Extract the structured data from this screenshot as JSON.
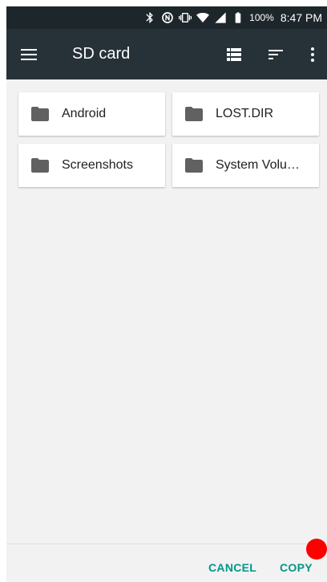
{
  "status_bar": {
    "icons": [
      "bluetooth-icon",
      "nfc-icon",
      "vibrate-icon",
      "wifi-icon",
      "signal-icon",
      "battery-icon"
    ],
    "battery_percent": "100%",
    "time": "8:47 PM"
  },
  "toolbar": {
    "title": "SD card",
    "menu_icon": "hamburger-menu-icon",
    "view_icon": "list-view-icon",
    "sort_icon": "sort-icon",
    "overflow_icon": "more-vert-icon"
  },
  "folders": [
    {
      "name": "Android",
      "icon": "folder-icon"
    },
    {
      "name": "LOST.DIR",
      "icon": "folder-icon"
    },
    {
      "name": "Screenshots",
      "icon": "folder-icon"
    },
    {
      "name": "System Volu…",
      "icon": "folder-icon"
    }
  ],
  "actions": {
    "cancel_label": "CANCEL",
    "copy_label": "COPY"
  },
  "colors": {
    "toolbar": "#263238",
    "status_bar": "#1d262b",
    "accent": "#009688",
    "folder_icon": "#616161",
    "background": "#f2f2f2"
  }
}
